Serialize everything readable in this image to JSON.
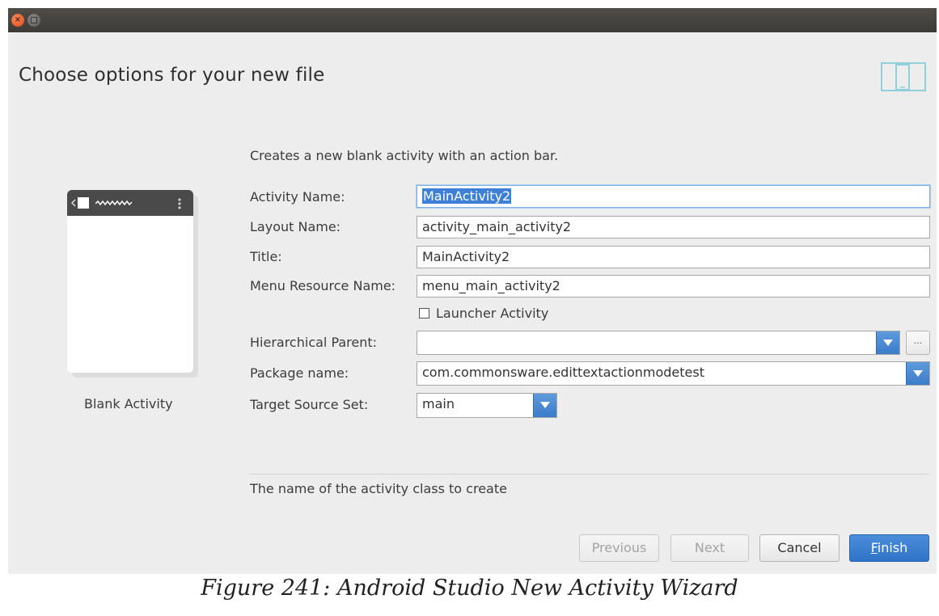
{
  "window": {
    "close_glyph": "×"
  },
  "header": {
    "title": "Choose options for your new file"
  },
  "description": "Creates a new blank activity with an action bar.",
  "preview": {
    "label": "Blank Activity"
  },
  "form": {
    "activity_name": {
      "label": "Activity Name:",
      "value": "MainActivity2"
    },
    "layout_name": {
      "label": "Layout Name:",
      "value": "activity_main_activity2"
    },
    "title": {
      "label": "Title:",
      "value": "MainActivity2"
    },
    "menu_resource_name": {
      "label": "Menu Resource Name:",
      "value": "menu_main_activity2"
    },
    "launcher_activity": {
      "label": "Launcher Activity",
      "checked": false
    },
    "hierarchical_parent": {
      "label": "Hierarchical Parent:",
      "value": "",
      "browse_label": "..."
    },
    "package_name": {
      "label": "Package name:",
      "value": "com.commonsware.edittextactionmodetest"
    },
    "target_source_set": {
      "label": "Target Source Set:",
      "value": "main"
    }
  },
  "hint": "The name of the activity class to create",
  "buttons": {
    "previous": "Previous",
    "next": "Next",
    "cancel": "Cancel",
    "finish_mnemonic": "F",
    "finish_rest": "inish"
  },
  "caption": "Figure 241: Android Studio New Activity Wizard",
  "colors": {
    "accent": "#3b7cc9",
    "background": "#ededed",
    "titlebar": "#3c3b37"
  }
}
